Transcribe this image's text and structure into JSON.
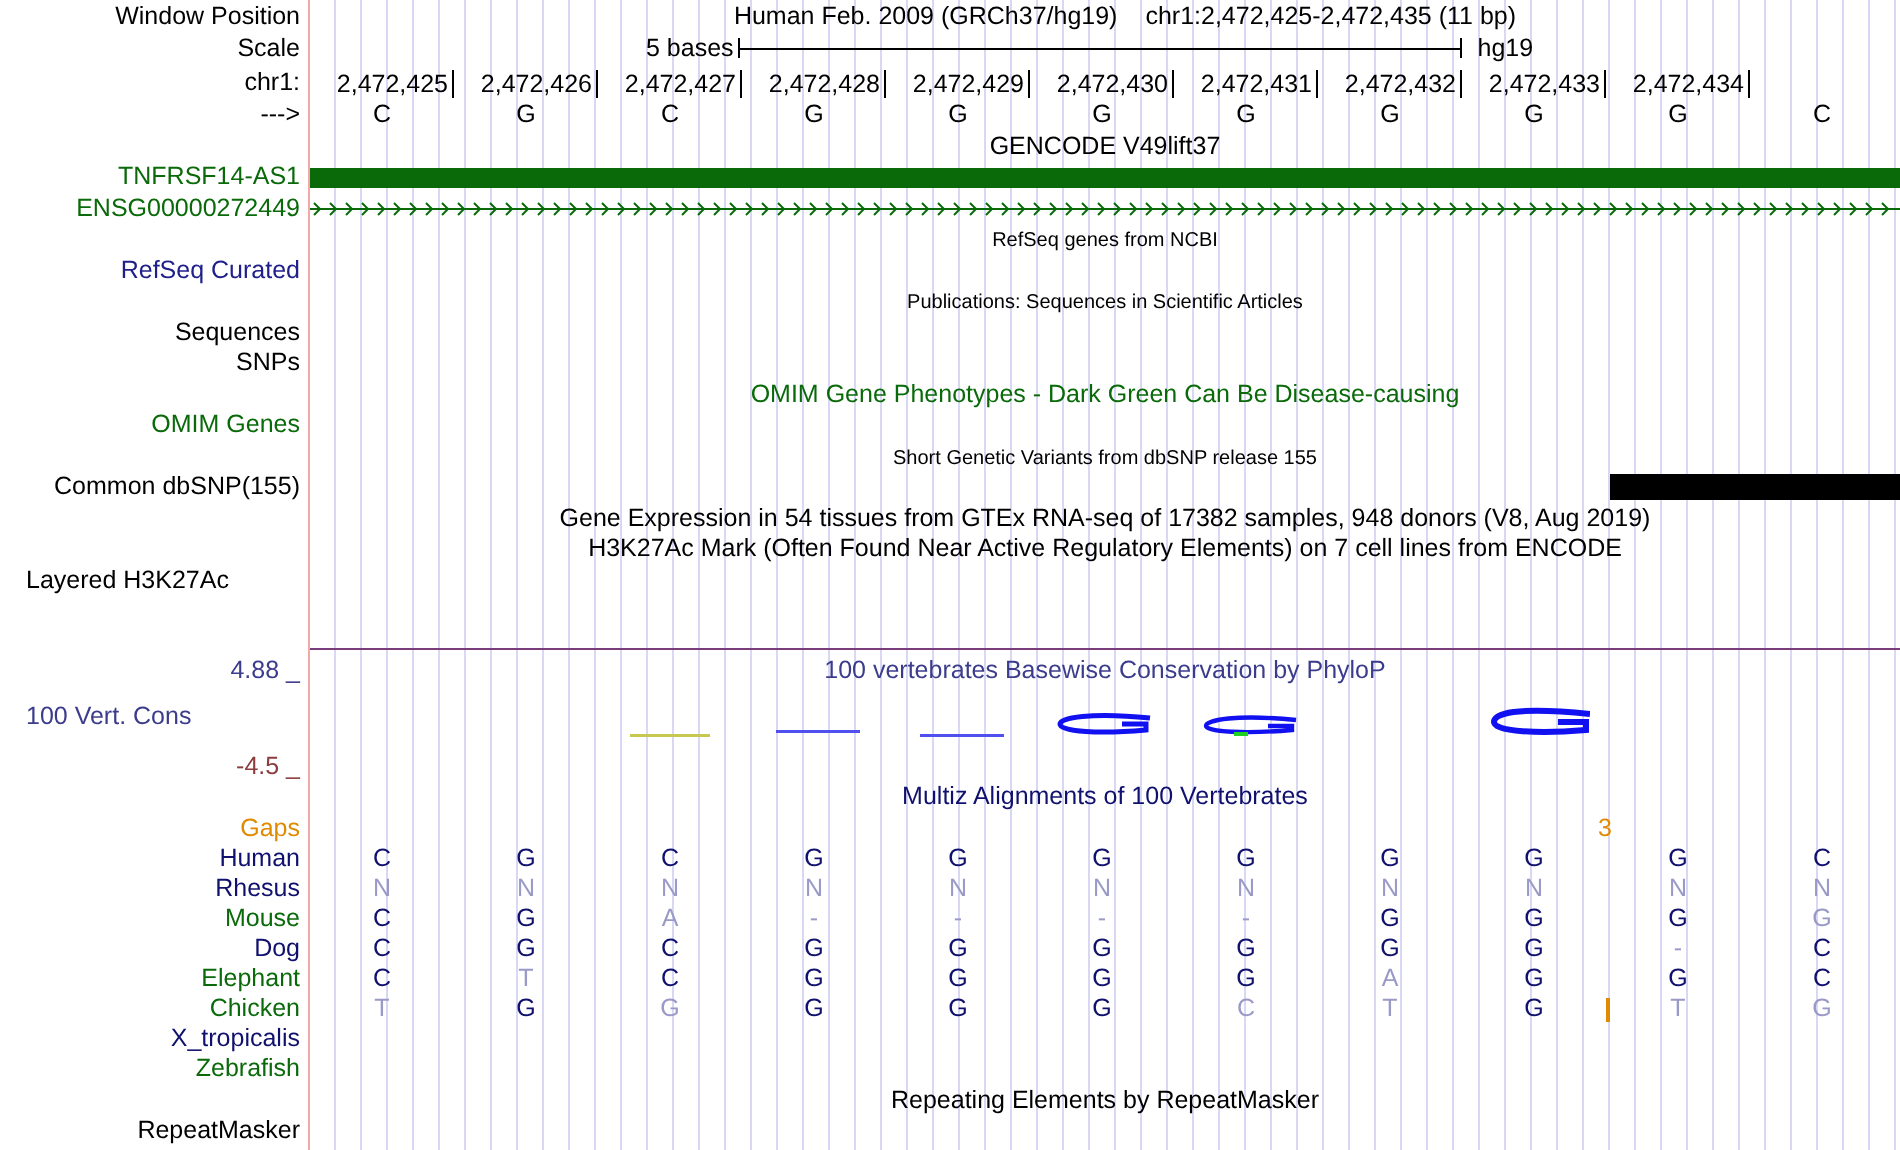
{
  "position": {
    "label": "Window Position",
    "assembly": "Human Feb. 2009 (GRCh37/hg19)",
    "range": "chr1:2,472,425-2,472,435 (11 bp)"
  },
  "scale": {
    "label": "Scale",
    "length": "5 bases",
    "database": "hg19"
  },
  "ruler": {
    "label": "chr1:",
    "positions": [
      "2,472,425",
      "2,472,426",
      "2,472,427",
      "2,472,428",
      "2,472,429",
      "2,472,430",
      "2,472,431",
      "2,472,432",
      "2,472,433",
      "2,472,434"
    ]
  },
  "sequence": {
    "label": "--->",
    "bases": [
      "C",
      "G",
      "C",
      "G",
      "G",
      "G",
      "G",
      "G",
      "G",
      "G",
      "C"
    ]
  },
  "tracks": [
    {
      "kind": "title",
      "text": "GENCODE V49lift37",
      "small": false,
      "color": "#000000"
    },
    {
      "kind": "gene",
      "label": "TNFRSF14-AS1",
      "color": "#0a6a0a"
    },
    {
      "kind": "transcript",
      "label": "ENSG00000272449",
      "color": "#0a6a0a"
    },
    {
      "kind": "title",
      "text": "RefSeq genes from NCBI",
      "small": true,
      "color": "#000000"
    },
    {
      "kind": "label",
      "label": "RefSeq Curated",
      "color": "#20208c"
    },
    {
      "kind": "title",
      "text": "Publications: Sequences in Scientific Articles",
      "small": true,
      "color": "#000000"
    },
    {
      "kind": "label",
      "label": "Sequences",
      "color": "#000000"
    },
    {
      "kind": "label",
      "label": "SNPs",
      "color": "#000000"
    },
    {
      "kind": "title",
      "text": "OMIM Gene Phenotypes - Dark Green Can Be Disease-causing",
      "small": false,
      "color": "#0a6a0a"
    },
    {
      "kind": "label",
      "label": "OMIM Genes",
      "color": "#0a6a0a"
    },
    {
      "kind": "title",
      "text": "Short Genetic Variants from dbSNP release 155",
      "small": true,
      "color": "#000000"
    },
    {
      "kind": "snp",
      "label": "Common dbSNP(155)",
      "color": "#000000"
    },
    {
      "kind": "title",
      "text": "Gene Expression in 54 tissues from GTEx RNA-seq of 17382 samples, 948 donors (V8, Aug 2019)",
      "small": false,
      "color": "#000000"
    },
    {
      "kind": "title",
      "text": "H3K27Ac Mark (Often Found Near Active Regulatory Elements) on 7 cell lines from ENCODE",
      "small": false,
      "color": "#000000"
    },
    {
      "kind": "layered",
      "label": "Layered H3K27Ac",
      "color": "#000000"
    },
    {
      "kind": "conservation",
      "label": "100 Vert. Cons",
      "title": "100 vertebrates Basewise Conservation by PhyloP",
      "max": "4.88 _",
      "min": "-4.5 _",
      "color": "#3c3c8c"
    },
    {
      "kind": "title",
      "text": "Multiz Alignments of 100 Vertebrates",
      "small": false,
      "color": "#10106e"
    },
    {
      "kind": "gaps",
      "label": "Gaps",
      "color": "#e08a00",
      "count": "3"
    },
    {
      "kind": "species",
      "label": "Human",
      "color": "#10106e",
      "bases": [
        {
          "base": "C",
          "dimmed": false,
          "insertion": false
        },
        {
          "base": "G",
          "dimmed": false,
          "insertion": false
        },
        {
          "base": "C",
          "dimmed": false,
          "insertion": false
        },
        {
          "base": "G",
          "dimmed": false,
          "insertion": false
        },
        {
          "base": "G",
          "dimmed": false,
          "insertion": false
        },
        {
          "base": "G",
          "dimmed": false,
          "insertion": false
        },
        {
          "base": "G",
          "dimmed": false,
          "insertion": false
        },
        {
          "base": "G",
          "dimmed": false,
          "insertion": false
        },
        {
          "base": "G",
          "dimmed": false,
          "insertion": false
        },
        {
          "base": "G",
          "dimmed": false,
          "insertion": false
        },
        {
          "base": "C",
          "dimmed": false,
          "insertion": false
        }
      ]
    },
    {
      "kind": "species",
      "label": "Rhesus",
      "color": "#10106e",
      "bases": [
        {
          "base": "N",
          "dimmed": true,
          "insertion": false
        },
        {
          "base": "N",
          "dimmed": true,
          "insertion": false
        },
        {
          "base": "N",
          "dimmed": true,
          "insertion": false
        },
        {
          "base": "N",
          "dimmed": true,
          "insertion": false
        },
        {
          "base": "N",
          "dimmed": true,
          "insertion": false
        },
        {
          "base": "N",
          "dimmed": true,
          "insertion": false
        },
        {
          "base": "N",
          "dimmed": true,
          "insertion": false
        },
        {
          "base": "N",
          "dimmed": true,
          "insertion": false
        },
        {
          "base": "N",
          "dimmed": true,
          "insertion": false
        },
        {
          "base": "N",
          "dimmed": true,
          "insertion": false
        },
        {
          "base": "N",
          "dimmed": true,
          "insertion": false
        }
      ]
    },
    {
      "kind": "species",
      "label": "Mouse",
      "color": "#0a6a0a",
      "bases": [
        {
          "base": "C",
          "dimmed": false,
          "insertion": false
        },
        {
          "base": "G",
          "dimmed": false,
          "insertion": false
        },
        {
          "base": "A",
          "dimmed": true,
          "insertion": false
        },
        {
          "base": "-",
          "dimmed": true,
          "insertion": false
        },
        {
          "base": "-",
          "dimmed": true,
          "insertion": false
        },
        {
          "base": "-",
          "dimmed": true,
          "insertion": false
        },
        {
          "base": "-",
          "dimmed": true,
          "insertion": false
        },
        {
          "base": "G",
          "dimmed": false,
          "insertion": false
        },
        {
          "base": "G",
          "dimmed": false,
          "insertion": false
        },
        {
          "base": "G",
          "dimmed": false,
          "insertion": false
        },
        {
          "base": "G",
          "dimmed": true,
          "insertion": false
        }
      ]
    },
    {
      "kind": "species",
      "label": "Dog",
      "color": "#10106e",
      "bases": [
        {
          "base": "C",
          "dimmed": false,
          "insertion": false
        },
        {
          "base": "G",
          "dimmed": false,
          "insertion": false
        },
        {
          "base": "C",
          "dimmed": false,
          "insertion": false
        },
        {
          "base": "G",
          "dimmed": false,
          "insertion": false
        },
        {
          "base": "G",
          "dimmed": false,
          "insertion": false
        },
        {
          "base": "G",
          "dimmed": false,
          "insertion": false
        },
        {
          "base": "G",
          "dimmed": false,
          "insertion": false
        },
        {
          "base": "G",
          "dimmed": false,
          "insertion": false
        },
        {
          "base": "G",
          "dimmed": false,
          "insertion": false
        },
        {
          "base": "-",
          "dimmed": true,
          "insertion": false
        },
        {
          "base": "C",
          "dimmed": false,
          "insertion": false
        }
      ]
    },
    {
      "kind": "species",
      "label": "Elephant",
      "color": "#0a6a0a",
      "bases": [
        {
          "base": "C",
          "dimmed": false,
          "insertion": false
        },
        {
          "base": "T",
          "dimmed": true,
          "insertion": false
        },
        {
          "base": "C",
          "dimmed": false,
          "insertion": false
        },
        {
          "base": "G",
          "dimmed": false,
          "insertion": false
        },
        {
          "base": "G",
          "dimmed": false,
          "insertion": false
        },
        {
          "base": "G",
          "dimmed": false,
          "insertion": false
        },
        {
          "base": "G",
          "dimmed": false,
          "insertion": false
        },
        {
          "base": "A",
          "dimmed": true,
          "insertion": false
        },
        {
          "base": "G",
          "dimmed": false,
          "insertion": false
        },
        {
          "base": "G",
          "dimmed": false,
          "insertion": false
        },
        {
          "base": "C",
          "dimmed": false,
          "insertion": false
        }
      ]
    },
    {
      "kind": "species",
      "label": "Chicken",
      "color": "#0a6a0a",
      "bases": [
        {
          "base": "T",
          "dimmed": true,
          "insertion": false
        },
        {
          "base": "G",
          "dimmed": false,
          "insertion": false
        },
        {
          "base": "G",
          "dimmed": true,
          "insertion": false
        },
        {
          "base": "G",
          "dimmed": false,
          "insertion": false
        },
        {
          "base": "G",
          "dimmed": false,
          "insertion": false
        },
        {
          "base": "G",
          "dimmed": false,
          "insertion": false
        },
        {
          "base": "C",
          "dimmed": true,
          "insertion": false
        },
        {
          "base": "T",
          "dimmed": true,
          "insertion": false
        },
        {
          "base": "G",
          "dimmed": false,
          "insertion": false
        },
        {
          "base": "T",
          "dimmed": true,
          "insertion": true
        },
        {
          "base": "G",
          "dimmed": true,
          "insertion": false
        }
      ]
    },
    {
      "kind": "label",
      "label": "X_tropicalis",
      "color": "#10106e"
    },
    {
      "kind": "label",
      "label": "Zebrafish",
      "color": "#0a6a0a"
    },
    {
      "kind": "title",
      "text": "Repeating Elements by RepeatMasker",
      "small": false,
      "color": "#000000"
    },
    {
      "kind": "label",
      "label": "RepeatMasker",
      "color": "#000000"
    }
  ]
}
